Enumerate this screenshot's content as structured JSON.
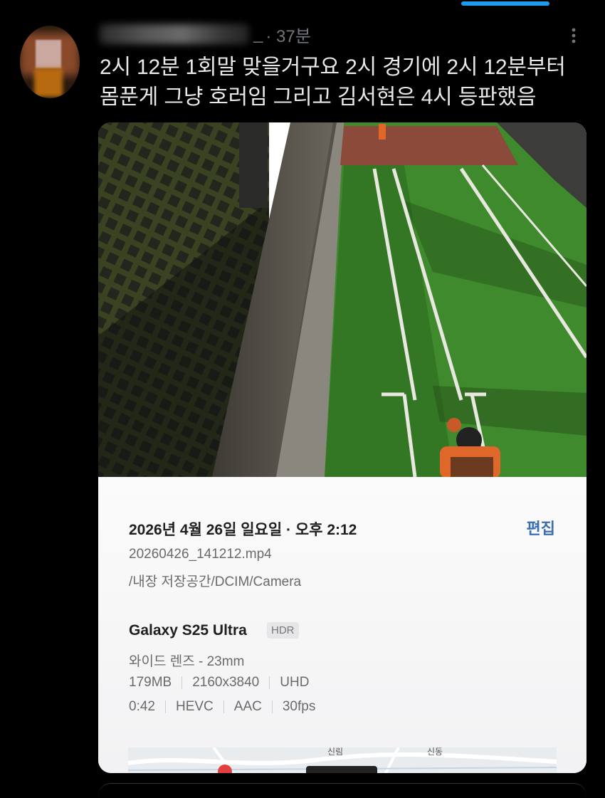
{
  "post": {
    "author_suffix": "_",
    "time": "· 37분",
    "more_icon": "more-vertical-icon",
    "text_line1": "2시 12분 1회말 맞을거구요 2시 경기에 2시 12분부터",
    "text_line2": "몸푼게 그냥 호러임 그리고 김서현은 4시 등판했음"
  },
  "media_info": {
    "date": "2026년 4월 26일 일요일 · 오후 2:12",
    "edit_label": "편집",
    "filename": "20260426_141212.mp4",
    "path": "/내장 저장공간/DCIM/Camera",
    "device": "Galaxy S25 Ultra",
    "hdr_badge": "HDR",
    "lens": "와이드 렌즈 - 23mm",
    "size": "179MB",
    "resolution": "2160x3840",
    "quality": "UHD",
    "duration": "0:42",
    "codec": "HEVC",
    "audio": "AAC",
    "fps": "30fps"
  },
  "map": {
    "labels": [
      "신림",
      "신동"
    ]
  },
  "colors": {
    "accent": "#1d9bf0",
    "edit_link": "#3b6fb0",
    "background": "#000000",
    "turf": "#3f8a2c",
    "mound": "#8b4a3a"
  }
}
